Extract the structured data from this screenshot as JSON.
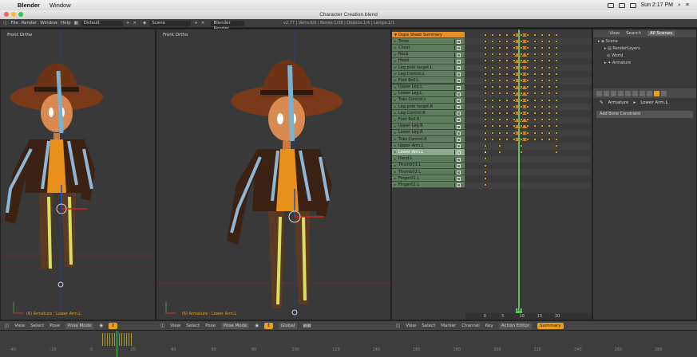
{
  "mac": {
    "app": "Blender",
    "menu_window": "Window",
    "clock": "Sun 2:17 PM"
  },
  "window": {
    "title": "Character Creation.blend"
  },
  "info": {
    "menus": [
      "File",
      "Render",
      "Window",
      "Help"
    ],
    "layout": "Default",
    "scene": "Scene",
    "engine": "Blender Render",
    "stats": "v2.77 | Verts:0/0 | Bones:1/38 | Objects:1/4 | Lamps:1/1"
  },
  "viewport_left": {
    "label": "Front Ortho",
    "object": "(6) Armature : Lower Arm.L"
  },
  "viewport_right": {
    "label": "Front Ortho",
    "object": "(6) Armature : Lower Arm.L"
  },
  "header_left": {
    "items": [
      "View",
      "Select",
      "Pose"
    ],
    "mode": "Pose Mode"
  },
  "header_right": {
    "items": [
      "View",
      "Select",
      "Pose"
    ],
    "mode": "Pose Mode",
    "orientation": "Global"
  },
  "dopesheet": {
    "summary": "Dope Sheet Summary",
    "channels": [
      "Torso",
      "Chest",
      "Neck",
      "Head",
      "Leg pole target.L",
      "Leg Control.L",
      "Foot Roll.L",
      "Upper Leg.L",
      "Lower Leg.L",
      "Toes Control.L",
      "Leg pole target.R",
      "Leg Control.R",
      "Foot Roll.R",
      "Upper Leg.R",
      "Lower Leg.R",
      "Toes Control.R",
      "Upper Arm.L",
      "Lower Arm.L",
      "Hand.L",
      "Thumb01.L",
      "Thumb02.L",
      "Finger01.L",
      "Finger02.L"
    ],
    "ruler": [
      "0",
      "5",
      "10",
      "15",
      "20"
    ],
    "current_frame": "10",
    "header_items": [
      "View",
      "Select",
      "Marker",
      "Channel",
      "Key"
    ],
    "mode": "Action Editor",
    "summary_btn": "Summary"
  },
  "timeline": {
    "ticks": [
      "-40",
      "-20",
      "0",
      "20",
      "40",
      "60",
      "80",
      "100",
      "120",
      "140",
      "160",
      "180",
      "200",
      "220",
      "240",
      "260",
      "280"
    ]
  },
  "outliner": {
    "tabs": [
      "View",
      "Search",
      "All Scenes"
    ],
    "rows": [
      "Scene",
      "RenderLayers",
      "World",
      "Armature"
    ]
  },
  "properties": {
    "path_1": "Armature",
    "path_2": "Lower Arm.L",
    "add_constraint": "Add Bone Constraint"
  },
  "colors": {
    "accent": "#e8a020",
    "channel": "#5d7d5d",
    "cursor": "#5dc25d"
  }
}
